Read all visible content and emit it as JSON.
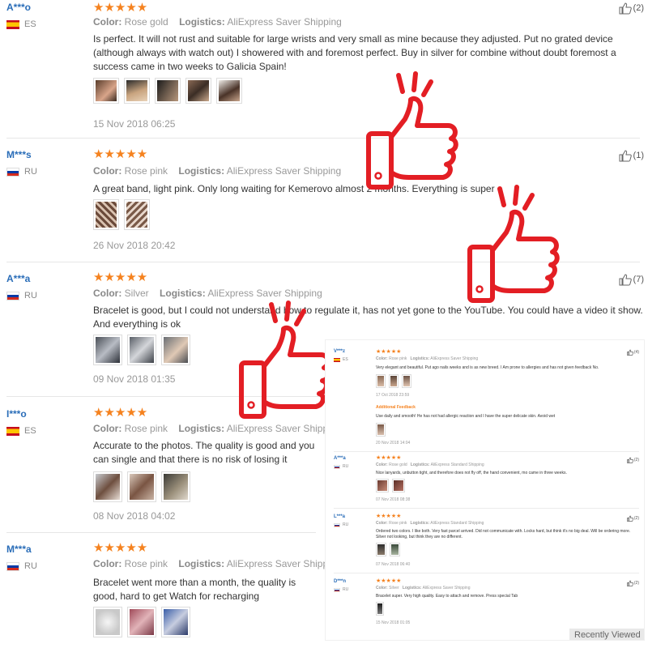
{
  "reviews": [
    {
      "user": "A***o",
      "country": "ES",
      "stars": "★★★★★",
      "color_label": "Color:",
      "color": "Rose gold",
      "logistics_label": "Logistics:",
      "logistics": "AliExpress Saver Shipping",
      "text": "Is perfect. It will not rust and suitable for large wrists and very small as mine because they adjusted. Put no grated device (although always with watch out) I showered with and foremost perfect. Buy in silver for combine without doubt foremost a success came in two weeks to Galicia Spain!",
      "date": "15 Nov 2018 06:25",
      "helpful": "(2)"
    },
    {
      "user": "M***s",
      "country": "RU",
      "stars": "★★★★★",
      "color_label": "Color:",
      "color": "Rose pink",
      "logistics_label": "Logistics:",
      "logistics": "AliExpress Saver Shipping",
      "text": "A great band, light pink. Only long waiting for Kemerovo almost 2 months. Everything is super",
      "date": "26 Nov 2018 20:42",
      "helpful": "(1)"
    },
    {
      "user": "A***a",
      "country": "RU",
      "stars": "★★★★★",
      "color_label": "Color:",
      "color": "Silver",
      "logistics_label": "Logistics:",
      "logistics": "AliExpress Saver Shipping",
      "text": "Bracelet is good, but I could not understand how to regulate it, has not yet gone to the YouTube. You could have a video it show. And everything is ok",
      "date": "09 Nov 2018 01:35",
      "helpful": "(7)"
    },
    {
      "user": "I***o",
      "country": "ES",
      "stars": "★★★★★",
      "color_label": "Color:",
      "color": "Rose pink",
      "logistics_label": "Logistics:",
      "logistics": "AliExpress Saver Shipping",
      "text": "Accurate to the photos. The quality is good and you can single and that there is no risk of losing it",
      "date": "08 Nov 2018 04:02",
      "helpful": ""
    },
    {
      "user": "M***a",
      "country": "RU",
      "stars": "★★★★★",
      "color_label": "Color:",
      "color": "Rose pink",
      "logistics_label": "Logistics:",
      "logistics": "AliExpress Saver Shipping",
      "text": "Bracelet went more than a month, the quality is good, hard to get Watch for recharging",
      "date": "",
      "helpful": ""
    }
  ],
  "inset": {
    "reviews": [
      {
        "user": "V***z",
        "country": "ES",
        "stars": "★★★★★",
        "color_label": "Color:",
        "color": "Rose pink",
        "logistics_label": "Logistics:",
        "logistics": "AliExpress Saver Shipping",
        "text": "Very elegant and beautiful. Put ago nails weeks and is as new breed. I Am prone to allergies and has not given feedback No.",
        "date": "17 Oct 2018 23:59",
        "helpful": "(4)",
        "additional_label": "Additional Feedback",
        "additional_text": "Use daily and smooth! He has not had allergic reaction and I have the super delicate skin. Avoid wet",
        "additional_date": "20 Nov 2018 14:04"
      },
      {
        "user": "A***a",
        "country": "RU",
        "stars": "★★★★★",
        "color_label": "Color:",
        "color": "Rose gold",
        "logistics_label": "Logistics:",
        "logistics": "AliExpress Standard Shipping",
        "text": "Nice lanyards, unbutton tight, and therefore does not fly off, the hand convenient, mo came in three weeks.",
        "date": "07 Nov 2018 08:38",
        "helpful": "(2)"
      },
      {
        "user": "L***a",
        "country": "RU",
        "stars": "★★★★★",
        "color_label": "Color:",
        "color": "Rose pink",
        "logistics_label": "Logistics:",
        "logistics": "AliExpress Standard Shipping",
        "text": "Ordered two colors. I like both. Very fast parcel arrived. Did not communicate with. Locks hard, but think it's no big deal. Will be ordering more. Silver not looking, but think they are no different.",
        "date": "07 Nov 2018 06:40",
        "helpful": "(2)"
      },
      {
        "user": "D***n",
        "country": "RU",
        "stars": "★★★★★",
        "color_label": "Color:",
        "color": "Silver",
        "logistics_label": "Logistics:",
        "logistics": "AliExpress Saver Shipping",
        "text": "Bracelet super. Very high quality. Easy to attach and remove. Press special Tab",
        "date": "15 Nov 2018 01:05",
        "helpful": "(2)"
      }
    ],
    "recently_viewed": "Recently Viewed"
  },
  "colors": {
    "star": "#f5821f",
    "user": "#2a6db8",
    "thumb_red": "#e31e24"
  }
}
